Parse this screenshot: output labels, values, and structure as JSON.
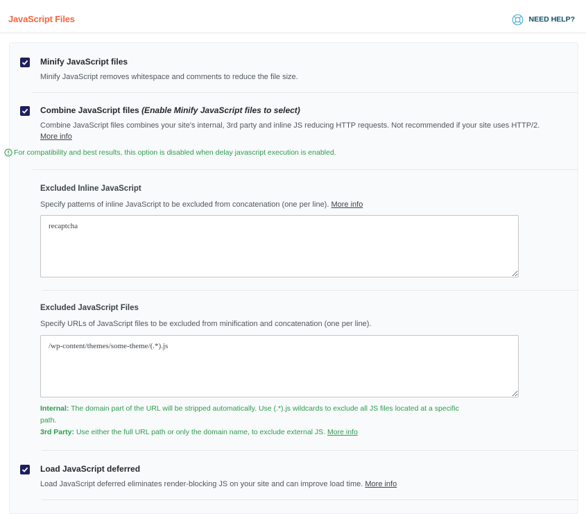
{
  "header": {
    "title": "JavaScript Files",
    "help_label": "NEED HELP?",
    "help_icon": "lifebuoy-icon"
  },
  "minify": {
    "checked": true,
    "label": "Minify JavaScript files",
    "description": "Minify JavaScript removes whitespace and comments to reduce the file size."
  },
  "combine": {
    "checked": true,
    "label": "Combine JavaScript files",
    "label_note": "(Enable Minify JavaScript files to select)",
    "description": "Combine JavaScript files combines your site's internal, 3rd party and inline JS reducing HTTP requests. Not recommended if your site uses HTTP/2.",
    "more_info": "More info",
    "notice": "For compatibility and best results, this option is disabled when delay javascript execution is enabled."
  },
  "excluded_inline": {
    "label": "Excluded Inline JavaScript",
    "description": "Specify patterns of inline JavaScript to be excluded from concatenation (one per line).",
    "more_info": "More info",
    "value": "recaptcha"
  },
  "excluded_files": {
    "label": "Excluded JavaScript Files",
    "description": "Specify URLs of JavaScript files to be excluded from minification and concatenation (one per line).",
    "value": "/wp-content/themes/some-theme/(.*).js",
    "internal_label": "Internal:",
    "internal_text_line1": "The domain part of the URL will be stripped automatically. Use (.*).js wildcards to exclude all JS files located at a specific",
    "internal_text_line2": "path.",
    "third_party_label": "3rd Party:",
    "third_party_text": "Use either the full URL path or only the domain name, to exclude external JS.",
    "more_info": "More info"
  },
  "defer": {
    "checked": true,
    "label": "Load JavaScript deferred",
    "description": "Load JavaScript deferred eliminates render-blocking JS on your site and can improve load time.",
    "more_info": "More info"
  },
  "colors": {
    "title": "#f56640",
    "checkbox": "#1e1f5c",
    "notice_green": "#2a9d4e",
    "help": "#0e4e65"
  }
}
